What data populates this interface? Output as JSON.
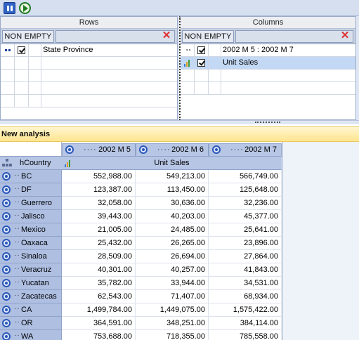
{
  "toolbar": {
    "pause_icon": "pause-icon",
    "play_icon": "play-icon"
  },
  "rows_panel": {
    "title": "Rows",
    "non_empty_label": "NON EMPTY",
    "items": [
      {
        "label": "State Province",
        "checked": true,
        "icon": "level-icon"
      }
    ]
  },
  "columns_panel": {
    "title": "Columns",
    "non_empty_label": "NON EMPTY",
    "items": [
      {
        "label": "2002 M 5 : 2002 M 7",
        "checked": true,
        "icon": "timeline-icon"
      },
      {
        "label": "Unit Sales",
        "checked": true,
        "icon": "measure-icon",
        "selected": true
      }
    ]
  },
  "analysis": {
    "title": "New analysis"
  },
  "pivot": {
    "hierarchy_label": "hCountry",
    "measure_label": "Unit Sales",
    "columns": [
      "2002 M 5",
      "2002 M 6",
      "2002 M 7"
    ],
    "rows": [
      {
        "label": "BC",
        "values": [
          "552,988.00",
          "549,213.00",
          "566,749.00"
        ]
      },
      {
        "label": "DF",
        "values": [
          "123,387.00",
          "113,450.00",
          "125,648.00"
        ]
      },
      {
        "label": "Guerrero",
        "values": [
          "32,058.00",
          "30,636.00",
          "32,236.00"
        ]
      },
      {
        "label": "Jalisco",
        "values": [
          "39,443.00",
          "40,203.00",
          "45,377.00"
        ]
      },
      {
        "label": "Mexico",
        "values": [
          "21,005.00",
          "24,485.00",
          "25,641.00"
        ]
      },
      {
        "label": "Oaxaca",
        "values": [
          "25,432.00",
          "26,265.00",
          "23,896.00"
        ]
      },
      {
        "label": "Sinaloa",
        "values": [
          "28,509.00",
          "26,694.00",
          "27,864.00"
        ]
      },
      {
        "label": "Veracruz",
        "values": [
          "40,301.00",
          "40,257.00",
          "41,843.00"
        ]
      },
      {
        "label": "Yucatan",
        "values": [
          "35,782.00",
          "33,944.00",
          "34,531.00"
        ]
      },
      {
        "label": "Zacatecas",
        "values": [
          "62,543.00",
          "71,407.00",
          "68,934.00"
        ]
      },
      {
        "label": "CA",
        "values": [
          "1,499,784.00",
          "1,449,075.00",
          "1,575,422.00"
        ]
      },
      {
        "label": "OR",
        "values": [
          "364,591.00",
          "348,251.00",
          "384,114.00"
        ]
      },
      {
        "label": "WA",
        "values": [
          "753,688.00",
          "718,355.00",
          "785,558.00"
        ]
      }
    ]
  },
  "colors": {
    "header_blue": "#b7c6e5",
    "title_yellow": "#ffe58f",
    "delete_red": "#e03030"
  }
}
